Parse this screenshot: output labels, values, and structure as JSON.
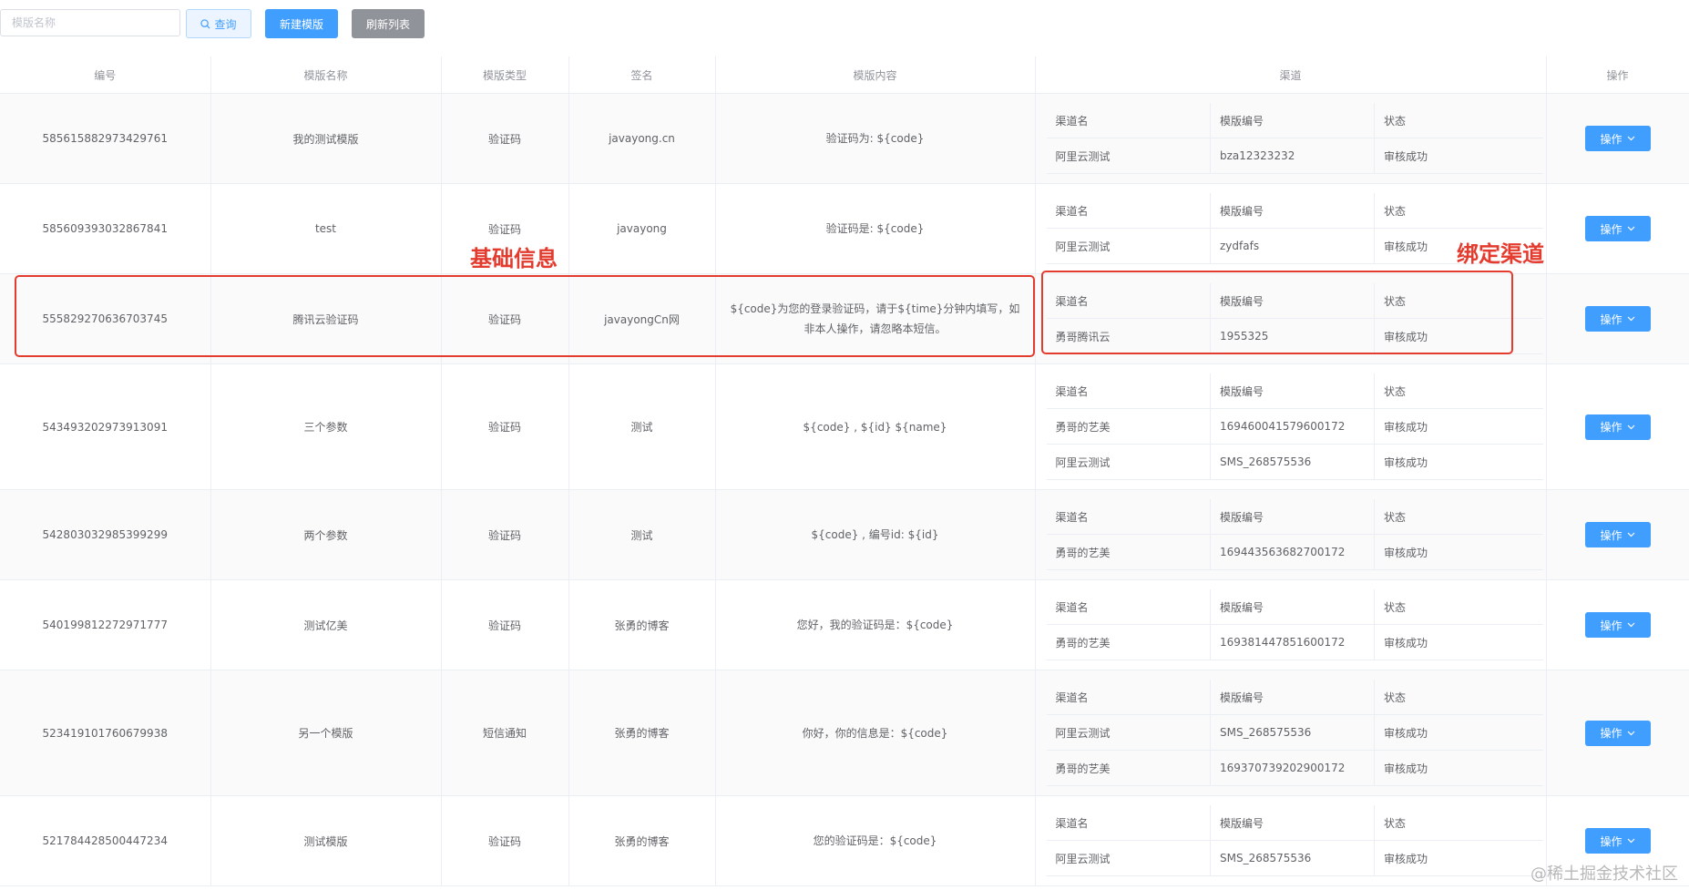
{
  "toolbar": {
    "search_placeholder": "模版名称",
    "query_label": "查询",
    "new_label": "新建模版",
    "refresh_label": "刷新列表"
  },
  "table": {
    "headers": [
      "编号",
      "模版名称",
      "模版类型",
      "签名",
      "模版内容",
      "渠道",
      "操作"
    ],
    "channel_headers": [
      "渠道名",
      "模版编号",
      "状态"
    ],
    "op_label": "操作",
    "rows": [
      {
        "id": "585615882973429761",
        "name": "我的测试模版",
        "type": "验证码",
        "sign": "javayong.cn",
        "content": "验证码为: ${code}",
        "channels": [
          {
            "name": "阿里云测试",
            "code": "bza12323232",
            "status": "审核成功"
          }
        ]
      },
      {
        "id": "585609393032867841",
        "name": "test",
        "type": "验证码",
        "sign": "javayong",
        "content": "验证码是: ${code}",
        "channels": [
          {
            "name": "阿里云测试",
            "code": "zydfafs",
            "status": "审核成功"
          }
        ]
      },
      {
        "id": "555829270636703745",
        "name": "腾讯云验证码",
        "type": "验证码",
        "sign": "javayongCn网",
        "content": "${code}为您的登录验证码，请于${time}分钟内填写，如非本人操作，请忽略本短信。",
        "channels": [
          {
            "name": "勇哥腾讯云",
            "code": "1955325",
            "status": "审核成功"
          }
        ]
      },
      {
        "id": "543493202973913091",
        "name": "三个参数",
        "type": "验证码",
        "sign": "测试",
        "content": "${code} , ${id} ${name}",
        "channels": [
          {
            "name": "勇哥的艺美",
            "code": "169460041579600172",
            "status": "审核成功"
          },
          {
            "name": "阿里云测试",
            "code": "SMS_268575536",
            "status": "审核成功"
          }
        ]
      },
      {
        "id": "542803032985399299",
        "name": "两个参数",
        "type": "验证码",
        "sign": "测试",
        "content": "${code} , 编号id: ${id}",
        "channels": [
          {
            "name": "勇哥的艺美",
            "code": "169443563682700172",
            "status": "审核成功"
          }
        ]
      },
      {
        "id": "540199812272971777",
        "name": "测试亿美",
        "type": "验证码",
        "sign": "张勇的博客",
        "content": "您好，我的验证码是：${code}",
        "channels": [
          {
            "name": "勇哥的艺美",
            "code": "169381447851600172",
            "status": "审核成功"
          }
        ]
      },
      {
        "id": "523419101760679938",
        "name": "另一个模版",
        "type": "短信通知",
        "sign": "张勇的博客",
        "content": "你好，你的信息是：${code}",
        "channels": [
          {
            "name": "阿里云测试",
            "code": "SMS_268575536",
            "status": "审核成功"
          },
          {
            "name": "勇哥的艺美",
            "code": "169370739202900172",
            "status": "审核成功"
          }
        ]
      },
      {
        "id": "521784428500447234",
        "name": "测试模版",
        "type": "验证码",
        "sign": "张勇的博客",
        "content": "您的验证码是：${code}",
        "channels": [
          {
            "name": "阿里云测试",
            "code": "SMS_268575536",
            "status": "审核成功"
          }
        ]
      }
    ]
  },
  "annotations": {
    "basic_info": "基础信息",
    "bind_channel": "绑定渠道"
  },
  "watermark": "@稀土掘金技术社区",
  "colors": {
    "primary": "#409eff",
    "annotation": "#e33b2e",
    "info": "#909399"
  }
}
